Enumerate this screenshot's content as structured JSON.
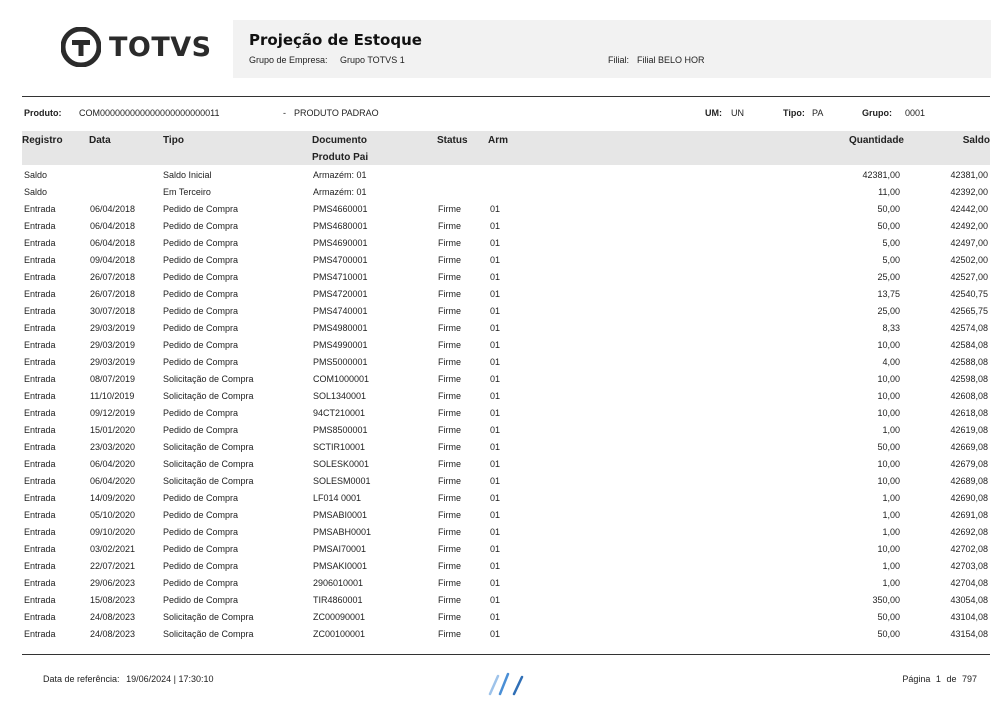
{
  "brand": {
    "logo_text": "TOTVS"
  },
  "header": {
    "title": "Projeção de Estoque",
    "grupo_empresa_label": "Grupo de Empresa:",
    "grupo_empresa_value": "Grupo TOTVS 1",
    "filial_label": "Filial:",
    "filial_value": "Filial BELO HOR"
  },
  "product": {
    "produto_label": "Produto:",
    "produto_code": "COM000000000000000000000011",
    "produto_sep": "-",
    "produto_name": "PRODUTO PADRAO",
    "um_label": "UM:",
    "um_value": "UN",
    "tipo_label": "Tipo:",
    "tipo_value": "PA",
    "grupo_label": "Grupo:",
    "grupo_value": "0001"
  },
  "columns": {
    "registro": "Registro",
    "data": "Data",
    "tipo": "Tipo",
    "documento": "Documento",
    "produto_pai": "Produto Pai",
    "status": "Status",
    "arm": "Arm",
    "quantidade": "Quantidade",
    "saldo": "Saldo"
  },
  "rows": [
    {
      "registro": "Saldo",
      "data": "",
      "tipo": "Saldo Inicial",
      "documento": "Armazém: 01",
      "status": "",
      "arm": "",
      "quantidade": "42381,00",
      "saldo": "42381,00"
    },
    {
      "registro": "Saldo",
      "data": "",
      "tipo": "Em Terceiro",
      "documento": "Armazém: 01",
      "status": "",
      "arm": "",
      "quantidade": "11,00",
      "saldo": "42392,00"
    },
    {
      "registro": "Entrada",
      "data": "06/04/2018",
      "tipo": "Pedido de Compra",
      "documento": "PMS4660001",
      "status": "Firme",
      "arm": "01",
      "quantidade": "50,00",
      "saldo": "42442,00"
    },
    {
      "registro": "Entrada",
      "data": "06/04/2018",
      "tipo": "Pedido de Compra",
      "documento": "PMS4680001",
      "status": "Firme",
      "arm": "01",
      "quantidade": "50,00",
      "saldo": "42492,00"
    },
    {
      "registro": "Entrada",
      "data": "06/04/2018",
      "tipo": "Pedido de Compra",
      "documento": "PMS4690001",
      "status": "Firme",
      "arm": "01",
      "quantidade": "5,00",
      "saldo": "42497,00"
    },
    {
      "registro": "Entrada",
      "data": "09/04/2018",
      "tipo": "Pedido de Compra",
      "documento": "PMS4700001",
      "status": "Firme",
      "arm": "01",
      "quantidade": "5,00",
      "saldo": "42502,00"
    },
    {
      "registro": "Entrada",
      "data": "26/07/2018",
      "tipo": "Pedido de Compra",
      "documento": "PMS4710001",
      "status": "Firme",
      "arm": "01",
      "quantidade": "25,00",
      "saldo": "42527,00"
    },
    {
      "registro": "Entrada",
      "data": "26/07/2018",
      "tipo": "Pedido de Compra",
      "documento": "PMS4720001",
      "status": "Firme",
      "arm": "01",
      "quantidade": "13,75",
      "saldo": "42540,75"
    },
    {
      "registro": "Entrada",
      "data": "30/07/2018",
      "tipo": "Pedido de Compra",
      "documento": "PMS4740001",
      "status": "Firme",
      "arm": "01",
      "quantidade": "25,00",
      "saldo": "42565,75"
    },
    {
      "registro": "Entrada",
      "data": "29/03/2019",
      "tipo": "Pedido de Compra",
      "documento": "PMS4980001",
      "status": "Firme",
      "arm": "01",
      "quantidade": "8,33",
      "saldo": "42574,08"
    },
    {
      "registro": "Entrada",
      "data": "29/03/2019",
      "tipo": "Pedido de Compra",
      "documento": "PMS4990001",
      "status": "Firme",
      "arm": "01",
      "quantidade": "10,00",
      "saldo": "42584,08"
    },
    {
      "registro": "Entrada",
      "data": "29/03/2019",
      "tipo": "Pedido de Compra",
      "documento": "PMS5000001",
      "status": "Firme",
      "arm": "01",
      "quantidade": "4,00",
      "saldo": "42588,08"
    },
    {
      "registro": "Entrada",
      "data": "08/07/2019",
      "tipo": "Solicitação de Compra",
      "documento": "COM1000001",
      "status": "Firme",
      "arm": "01",
      "quantidade": "10,00",
      "saldo": "42598,08"
    },
    {
      "registro": "Entrada",
      "data": "11/10/2019",
      "tipo": "Solicitação de Compra",
      "documento": "SOL1340001",
      "status": "Firme",
      "arm": "01",
      "quantidade": "10,00",
      "saldo": "42608,08"
    },
    {
      "registro": "Entrada",
      "data": "09/12/2019",
      "tipo": "Pedido de Compra",
      "documento": "94CT210001",
      "status": "Firme",
      "arm": "01",
      "quantidade": "10,00",
      "saldo": "42618,08"
    },
    {
      "registro": "Entrada",
      "data": "15/01/2020",
      "tipo": "Pedido de Compra",
      "documento": "PMS8500001",
      "status": "Firme",
      "arm": "01",
      "quantidade": "1,00",
      "saldo": "42619,08"
    },
    {
      "registro": "Entrada",
      "data": "23/03/2020",
      "tipo": "Solicitação de Compra",
      "documento": "SCTIR10001",
      "status": "Firme",
      "arm": "01",
      "quantidade": "50,00",
      "saldo": "42669,08"
    },
    {
      "registro": "Entrada",
      "data": "06/04/2020",
      "tipo": "Solicitação de Compra",
      "documento": "SOLESK0001",
      "status": "Firme",
      "arm": "01",
      "quantidade": "10,00",
      "saldo": "42679,08"
    },
    {
      "registro": "Entrada",
      "data": "06/04/2020",
      "tipo": "Solicitação de Compra",
      "documento": "SOLESM0001",
      "status": "Firme",
      "arm": "01",
      "quantidade": "10,00",
      "saldo": "42689,08"
    },
    {
      "registro": "Entrada",
      "data": "14/09/2020",
      "tipo": "Pedido de Compra",
      "documento": "LF014 0001",
      "status": "Firme",
      "arm": "01",
      "quantidade": "1,00",
      "saldo": "42690,08"
    },
    {
      "registro": "Entrada",
      "data": "05/10/2020",
      "tipo": "Pedido de Compra",
      "documento": "PMSABI0001",
      "status": "Firme",
      "arm": "01",
      "quantidade": "1,00",
      "saldo": "42691,08"
    },
    {
      "registro": "Entrada",
      "data": "09/10/2020",
      "tipo": "Pedido de Compra",
      "documento": "PMSABH0001",
      "status": "Firme",
      "arm": "01",
      "quantidade": "1,00",
      "saldo": "42692,08"
    },
    {
      "registro": "Entrada",
      "data": "03/02/2021",
      "tipo": "Pedido de Compra",
      "documento": "PMSAI70001",
      "status": "Firme",
      "arm": "01",
      "quantidade": "10,00",
      "saldo": "42702,08"
    },
    {
      "registro": "Entrada",
      "data": "22/07/2021",
      "tipo": "Pedido de Compra",
      "documento": "PMSAKI0001",
      "status": "Firme",
      "arm": "01",
      "quantidade": "1,00",
      "saldo": "42703,08"
    },
    {
      "registro": "Entrada",
      "data": "29/06/2023",
      "tipo": "Pedido de Compra",
      "documento": "2906010001",
      "status": "Firme",
      "arm": "01",
      "quantidade": "1,00",
      "saldo": "42704,08"
    },
    {
      "registro": "Entrada",
      "data": "15/08/2023",
      "tipo": "Pedido de Compra",
      "documento": "TIR4860001",
      "status": "Firme",
      "arm": "01",
      "quantidade": "350,00",
      "saldo": "43054,08"
    },
    {
      "registro": "Entrada",
      "data": "24/08/2023",
      "tipo": "Solicitação de Compra",
      "documento": "ZC00090001",
      "status": "Firme",
      "arm": "01",
      "quantidade": "50,00",
      "saldo": "43104,08"
    },
    {
      "registro": "Entrada",
      "data": "24/08/2023",
      "tipo": "Solicitação de Compra",
      "documento": "ZC00100001",
      "status": "Firme",
      "arm": "01",
      "quantidade": "50,00",
      "saldo": "43154,08"
    }
  ],
  "footer": {
    "ref_label": "Data de referência:",
    "ref_value": "19/06/2024 | 17:30:10",
    "page_label": "Página",
    "page_current": "1",
    "page_of": "de",
    "page_total": "797"
  },
  "colors": {
    "header_bg": "#f2f2f2",
    "column_header_bg": "#e6e6e6",
    "logo": "#2b2b2b",
    "footer_mark": "#4a8fd6"
  },
  "icons": {
    "logo_mark": "totvs-logo-icon",
    "footer_mark": "report-mark-icon"
  }
}
